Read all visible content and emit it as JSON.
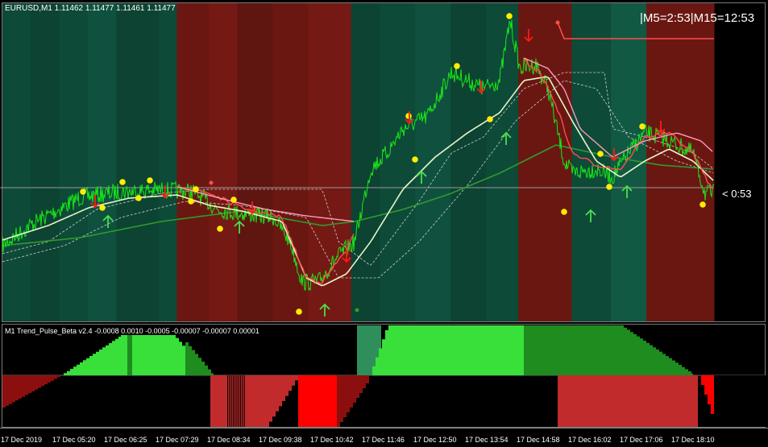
{
  "main_panel": {
    "symbol_info": "EURUSD,M1  1.11462 1.11477 1.11461 1.11477",
    "timer": "|M5=2:53|M15=12:53",
    "countdown": "< 0:53",
    "band_colors": {
      "green": "#0e4a38",
      "red": "#6a1712"
    },
    "bands": [
      {
        "color": "green",
        "shade": 1.0,
        "start": 0.0,
        "end": 0.04
      },
      {
        "color": "green",
        "shade": 0.9,
        "start": 0.04,
        "end": 0.08
      },
      {
        "color": "green",
        "shade": 1.0,
        "start": 0.08,
        "end": 0.12
      },
      {
        "color": "green",
        "shade": 1.1,
        "start": 0.12,
        "end": 0.16
      },
      {
        "color": "green",
        "shade": 0.9,
        "start": 0.16,
        "end": 0.22
      },
      {
        "color": "green",
        "shade": 1.0,
        "start": 0.22,
        "end": 0.245
      },
      {
        "color": "red",
        "shade": 1.0,
        "start": 0.245,
        "end": 0.29
      },
      {
        "color": "red",
        "shade": 1.1,
        "start": 0.29,
        "end": 0.33
      },
      {
        "color": "red",
        "shade": 0.9,
        "start": 0.33,
        "end": 0.38
      },
      {
        "color": "red",
        "shade": 1.0,
        "start": 0.38,
        "end": 0.43
      },
      {
        "color": "red",
        "shade": 1.1,
        "start": 0.43,
        "end": 0.49
      },
      {
        "color": "green",
        "shade": 0.9,
        "start": 0.49,
        "end": 0.53
      },
      {
        "color": "green",
        "shade": 1.0,
        "start": 0.53,
        "end": 0.58
      },
      {
        "color": "green",
        "shade": 1.1,
        "start": 0.58,
        "end": 0.63
      },
      {
        "color": "green",
        "shade": 0.9,
        "start": 0.63,
        "end": 0.68
      },
      {
        "color": "green",
        "shade": 1.0,
        "start": 0.68,
        "end": 0.725
      },
      {
        "color": "red",
        "shade": 1.0,
        "start": 0.725,
        "end": 0.8
      },
      {
        "color": "green",
        "shade": 1.0,
        "start": 0.8,
        "end": 0.855
      },
      {
        "color": "green",
        "shade": 1.2,
        "start": 0.855,
        "end": 0.905
      },
      {
        "color": "red",
        "shade": 1.0,
        "start": 0.905,
        "end": 1.0
      }
    ]
  },
  "indicator_panel": {
    "label": "M1 Trend_Pulse_Beta v2.4 -0.0008 0.0010 -0.0005   -0.00007 -0.00007 0.00001"
  },
  "time_axis": [
    "17 Dec 2019",
    "17 Dec 05:20",
    "17 Dec 06:25",
    "17 Dec 07:29",
    "17 Dec 08:34",
    "17 Dec 09:38",
    "17 Dec 10:42",
    "17 Dec 11:46",
    "17 Dec 12:50",
    "17 Dec 13:54",
    "17 Dec 14:58",
    "17 Dec 16:02",
    "17 Dec 17:06",
    "17 Dec 18:10"
  ],
  "colors": {
    "price": "#19e619",
    "fast_ma": "#ff4d4d",
    "slow_ma": "#ff99bb",
    "signal_line": "#e8f5c8",
    "trend_line": "#2f9a2f",
    "dot": "#ffee00",
    "down_arrow": "#ff1a1a",
    "up_arrow": "#4ddd4d",
    "hist_green_light": "#39e039",
    "hist_green_dark": "#1e8c1e",
    "hist_green_teal": "#2f8f5a",
    "hist_red_dark": "#8c0f0f",
    "hist_red_mid": "#c22b2b",
    "hist_red_bright": "#ff0000"
  }
}
